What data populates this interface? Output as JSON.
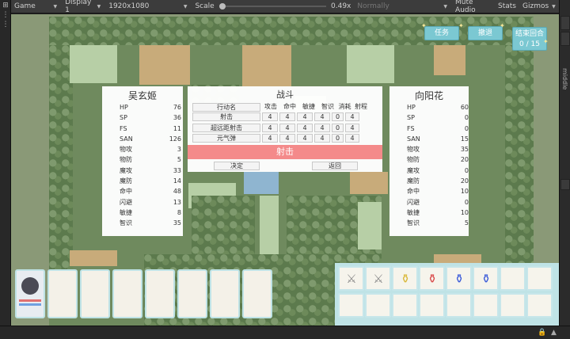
{
  "toolbar": {
    "game_tab": "Game",
    "display": "Display 1",
    "resolution": "1920x1080",
    "scale_label": "Scale",
    "scale_value": "0.49x",
    "play_mode": "Normally",
    "mute_audio": "Mute Audio",
    "stats": "Stats",
    "gizmos": "Gizmos"
  },
  "right_rail": {
    "label": "middle"
  },
  "hud": {
    "task_button": "任务",
    "undo_button": "撤退",
    "end_turn_button": "结束回合",
    "turn_counter": "0 / 15"
  },
  "left_character": {
    "name": "吴玄姬",
    "stats": [
      {
        "k": "HP",
        "v": "76"
      },
      {
        "k": "SP",
        "v": "36"
      },
      {
        "k": "FS",
        "v": "11"
      },
      {
        "k": "SAN",
        "v": "126"
      },
      {
        "k": "物攻",
        "v": "3"
      },
      {
        "k": "物防",
        "v": "5"
      },
      {
        "k": "魔攻",
        "v": "33"
      },
      {
        "k": "魔防",
        "v": "14"
      },
      {
        "k": "命中",
        "v": "48"
      },
      {
        "k": "闪避",
        "v": "13"
      },
      {
        "k": "敏捷",
        "v": "8"
      },
      {
        "k": "智识",
        "v": "35"
      }
    ]
  },
  "right_character": {
    "name": "向阳花",
    "stats": [
      {
        "k": "HP",
        "v": "60"
      },
      {
        "k": "SP",
        "v": "0"
      },
      {
        "k": "FS",
        "v": "0"
      },
      {
        "k": "SAN",
        "v": "15"
      },
      {
        "k": "物攻",
        "v": "35"
      },
      {
        "k": "物防",
        "v": "20"
      },
      {
        "k": "魔攻",
        "v": "0"
      },
      {
        "k": "魔防",
        "v": "20"
      },
      {
        "k": "命中",
        "v": "10"
      },
      {
        "k": "闪避",
        "v": "0"
      },
      {
        "k": "敏捷",
        "v": "10"
      },
      {
        "k": "智识",
        "v": "5"
      }
    ]
  },
  "battle": {
    "title": "战斗",
    "headers": [
      "行动名",
      "攻击",
      "命中",
      "敏捷",
      "智识",
      "消耗",
      "射程"
    ],
    "actions": [
      {
        "name": "射击",
        "vals": [
          "4",
          "4",
          "4",
          "4",
          "0",
          "4"
        ]
      },
      {
        "name": "超远距射击",
        "vals": [
          "4",
          "4",
          "4",
          "4",
          "0",
          "4"
        ]
      },
      {
        "name": "元气弹",
        "vals": [
          "4",
          "4",
          "4",
          "4",
          "0",
          "4"
        ]
      }
    ],
    "selected": "射击",
    "confirm": "决定",
    "back": "返回"
  },
  "colors": {
    "banner": "#f48a8a",
    "hud": "#7bc8d2",
    "card_border": "#bfe3e6"
  },
  "items": [
    "sword-icon",
    "sword-icon",
    "yellow-potion-icon",
    "red-potion-icon",
    "blue-potion-icon",
    "blue-potion-icon"
  ]
}
